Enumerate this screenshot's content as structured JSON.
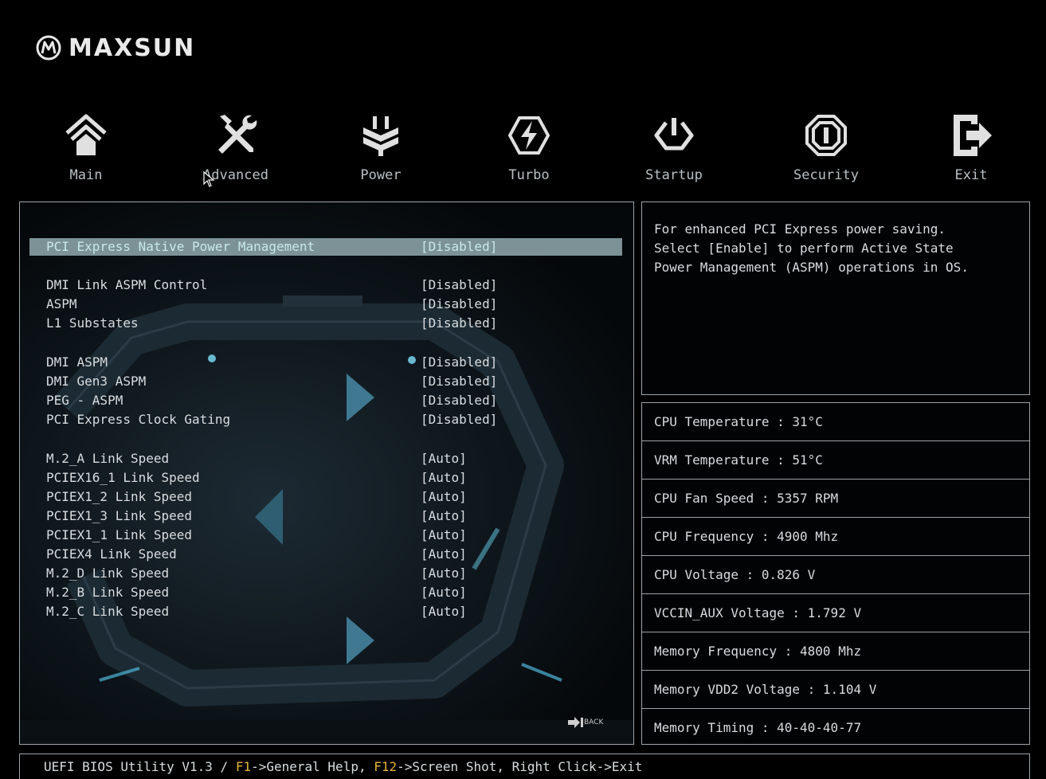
{
  "brand": {
    "name": "MAXSUN"
  },
  "nav": [
    {
      "label": "Main",
      "icon": "home-icon"
    },
    {
      "label": "Advanced",
      "icon": "tools-icon"
    },
    {
      "label": "Power",
      "icon": "power-plug-icon"
    },
    {
      "label": "Turbo",
      "icon": "lightning-icon"
    },
    {
      "label": "Startup",
      "icon": "power-button-icon"
    },
    {
      "label": "Security",
      "icon": "shield-lock-icon"
    },
    {
      "label": "Exit",
      "icon": "exit-arrow-icon"
    }
  ],
  "settings": [
    {
      "name": "PCI Express Native Power Management",
      "value": "[Disabled]"
    },
    {
      "name": "DMI Link ASPM Control",
      "value": "[Disabled]"
    },
    {
      "name": "ASPM",
      "value": "[Disabled]"
    },
    {
      "name": "L1 Substates",
      "value": "[Disabled]"
    },
    {
      "name": "DMI ASPM",
      "value": "[Disabled]"
    },
    {
      "name": "DMI Gen3 ASPM",
      "value": "[Disabled]"
    },
    {
      "name": "PEG - ASPM",
      "value": "[Disabled]"
    },
    {
      "name": "PCI Express Clock Gating",
      "value": "[Disabled]"
    },
    {
      "name": "M.2_A Link Speed",
      "value": "[Auto]"
    },
    {
      "name": "PCIEX16_1 Link Speed",
      "value": "[Auto]"
    },
    {
      "name": "PCIEX1_2 Link Speed",
      "value": "[Auto]"
    },
    {
      "name": "PCIEX1_3 Link Speed",
      "value": "[Auto]"
    },
    {
      "name": "PCIEX1_1 Link Speed",
      "value": "[Auto]"
    },
    {
      "name": "PCIEX4 Link Speed",
      "value": "[Auto]"
    },
    {
      "name": "M.2_D Link Speed",
      "value": "[Auto]"
    },
    {
      "name": "M.2_B Link Speed",
      "value": "[Auto]"
    },
    {
      "name": "M.2_C Link Speed",
      "value": "[Auto]"
    }
  ],
  "help": {
    "line1": "For enhanced PCI Express power saving.",
    "line2": "Select [Enable] to perform Active State",
    "line3": "Power Management (ASPM) operations in OS."
  },
  "status": [
    "CPU Temperature : 31°C",
    "VRM Temperature : 51°C",
    "CPU Fan Speed : 5357 RPM",
    "CPU Frequency : 4900 Mhz",
    "CPU Voltage : 0.826 V",
    "VCCIN_AUX Voltage : 1.792 V",
    "Memory Frequency : 4800 Mhz",
    "Memory VDD2 Voltage : 1.104 V",
    "Memory Timing : 40-40-40-77"
  ],
  "back_label": "BACK",
  "footer": {
    "prefix": "UEFI BIOS Utility V1.3 / ",
    "key1": "F1",
    "desc1": "->General Help, ",
    "key2": "F12",
    "desc2": "->Screen Shot, Right Click->Exit"
  },
  "colors": {
    "highlight": "#7c9296",
    "hotkey": "#e3b534",
    "border": "#9ba3a8"
  }
}
